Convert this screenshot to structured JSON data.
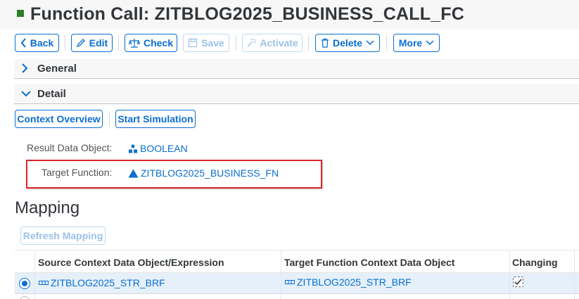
{
  "page": {
    "title": "Function Call: ZITBLOG2025_BUSINESS_CALL_FC"
  },
  "toolbar": {
    "back": "Back",
    "edit": "Edit",
    "check": "Check",
    "save": "Save",
    "activate": "Activate",
    "delete": "Delete",
    "more": "More"
  },
  "sections": {
    "general": "General",
    "detail": "Detail"
  },
  "detail": {
    "context_overview": "Context Overview",
    "start_simulation": "Start Simulation",
    "result_label": "Result Data Object:",
    "result_value": "BOOLEAN",
    "target_label": "Target Function:",
    "target_value": "ZITBLOG2025_BUSINESS_FN"
  },
  "mapping": {
    "title": "Mapping",
    "refresh": "Refresh Mapping",
    "columns": [
      "Source Context Data Object/Expression",
      "Target Function Context Data Object",
      "Changing"
    ],
    "rows": [
      {
        "source": "ZITBLOG2025_STR_BRF",
        "target": "ZITBLOG2025_STR_BRF",
        "changing": true,
        "selected": true
      }
    ]
  },
  "colors": {
    "accent": "#0a6ed1",
    "title_icon": "#2b7d2b",
    "highlight": "#d9262a",
    "selected_row": "#e5f0fa"
  }
}
